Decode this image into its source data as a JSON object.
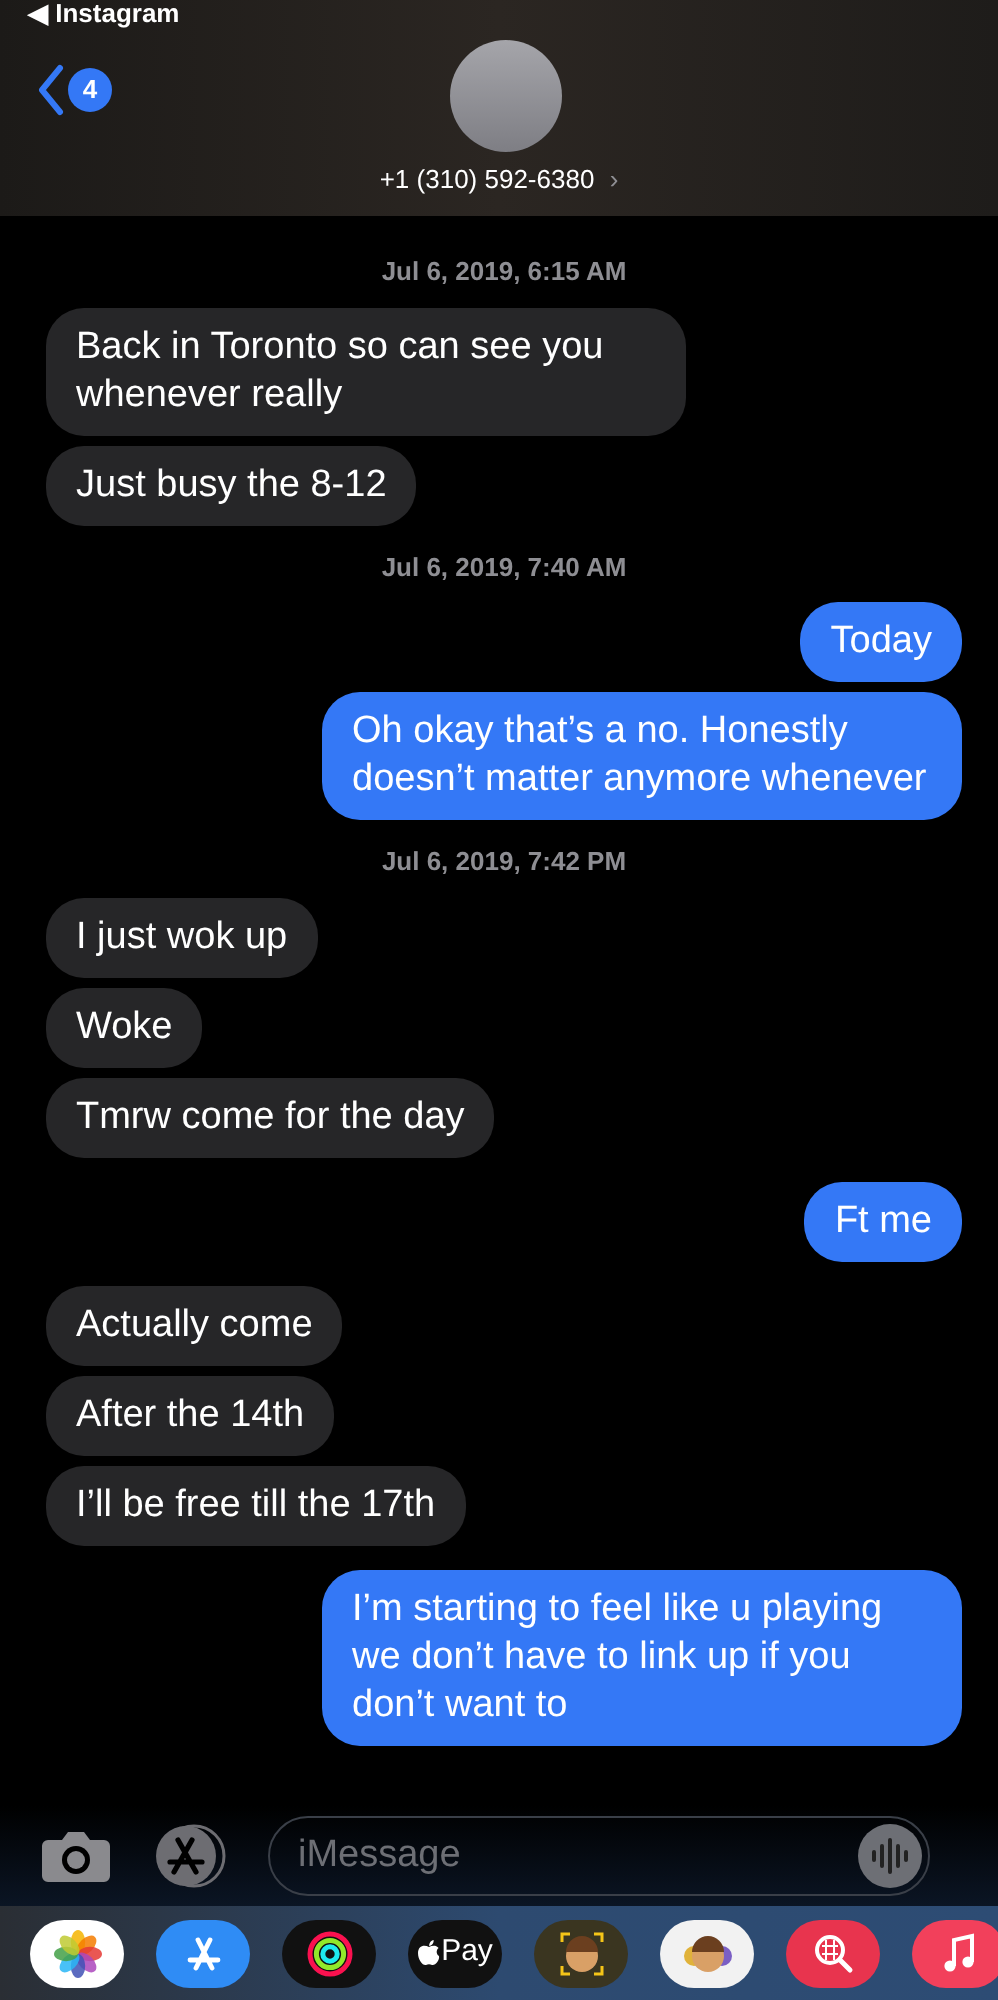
{
  "status_bar": {
    "back_app": "◀ Instagram"
  },
  "header": {
    "unread_count": "4",
    "contact": "+1 (310) 592-6380",
    "chevron": "›"
  },
  "messages": [
    {
      "kind": "timestamp",
      "text": "Jul 6, 2019, 6:15 AM"
    },
    {
      "kind": "incoming",
      "text": "Back in Toronto so can see you whenever really"
    },
    {
      "kind": "incoming",
      "text": "Just busy the 8-12"
    },
    {
      "kind": "timestamp",
      "text": "Jul 6, 2019, 7:40 AM"
    },
    {
      "kind": "outgoing",
      "text": "Today"
    },
    {
      "kind": "outgoing",
      "text": "Oh okay that’s a no. Honestly doesn’t matter anymore whenever"
    },
    {
      "kind": "timestamp",
      "text": "Jul 6, 2019, 7:42 PM"
    },
    {
      "kind": "incoming",
      "text": "I just wok up"
    },
    {
      "kind": "incoming",
      "text": "Woke"
    },
    {
      "kind": "incoming",
      "text": "Tmrw come for the day"
    },
    {
      "kind": "outgoing",
      "text": "Ft me"
    },
    {
      "kind": "incoming",
      "text": "Actually come"
    },
    {
      "kind": "incoming",
      "text": "After the 14th"
    },
    {
      "kind": "incoming",
      "text": "I’ll be free till the 17th"
    },
    {
      "kind": "outgoing",
      "text": "I’m starting to feel like u playing we don’t have to link up if you don’t want to"
    }
  ],
  "composer": {
    "placeholder": "iMessage"
  },
  "app_drawer": [
    {
      "kind": "photos"
    },
    {
      "kind": "app-store"
    },
    {
      "kind": "activity"
    },
    {
      "kind": "apple-pay",
      "label": "Pay"
    },
    {
      "kind": "memoji"
    },
    {
      "kind": "memoji-stickers"
    },
    {
      "kind": "image-search"
    },
    {
      "kind": "music"
    }
  ]
}
